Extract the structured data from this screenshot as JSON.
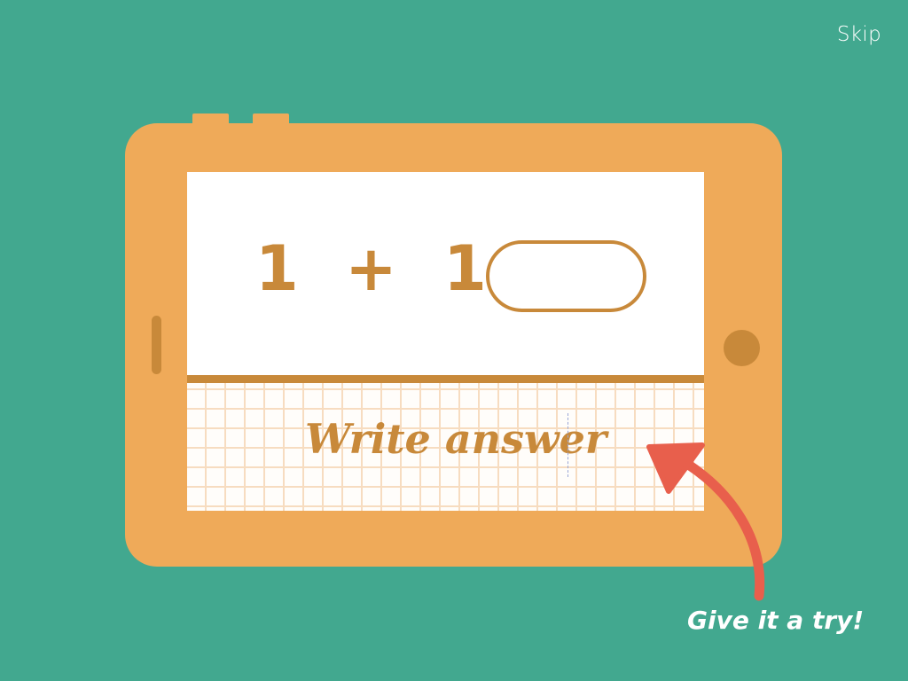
{
  "header": {
    "skip_label": "Skip"
  },
  "tutorial": {
    "equation_text": "1 + 1 =",
    "answer_value": "",
    "write_hint": "Write answer",
    "try_label": "Give it a try!"
  },
  "colors": {
    "background": "#42a88f",
    "tablet_body": "#efaa59",
    "tablet_accent": "#c8893a",
    "screen": "#ffffff",
    "grid_line": "#f7dcc0",
    "arrow": "#e85f4c",
    "text_light": "#ffffff"
  },
  "icons": {
    "arrow": "curved-arrow-icon",
    "home_button": "home-button-icon"
  }
}
